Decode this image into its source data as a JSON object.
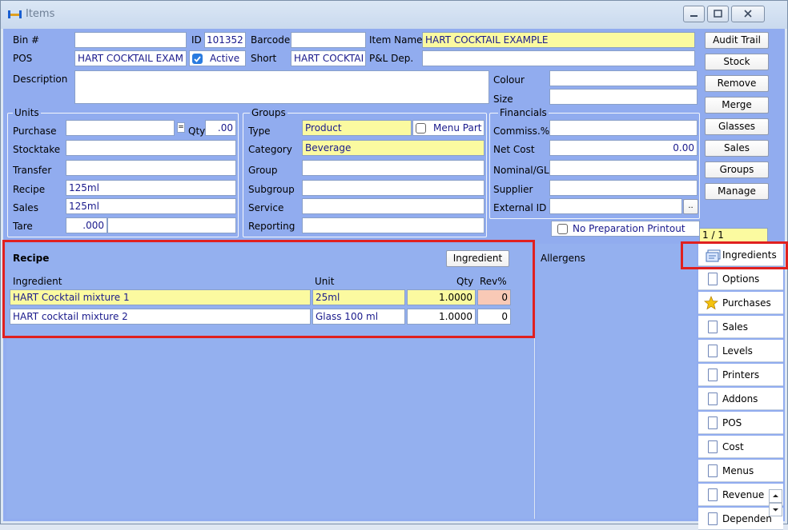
{
  "window": {
    "title": "Items"
  },
  "header": {
    "bin_label": "Bin #",
    "bin_value": "",
    "id_label": "ID",
    "id_value": "101352",
    "barcode_label": "Barcode",
    "barcode_value": "",
    "item_name_label": "Item Name",
    "item_name_value": "HART COCKTAIL EXAMPLE",
    "pos_label": "POS",
    "pos_value": "HART COCKTAIL EXAM",
    "active_label": "Active",
    "active_checked": true,
    "short_label": "Short",
    "short_value": "HART COCKTAI",
    "pl_dep_label": "P&L Dep.",
    "pl_dep_value": "",
    "description_label": "Description",
    "description_value": "",
    "colour_label": "Colour",
    "colour_value": "",
    "size_label": "Size",
    "size_value": ""
  },
  "units": {
    "title": "Units",
    "purchase_label": "Purchase",
    "purchase_value": "",
    "eq_label": "=",
    "qty_label": "Qty",
    "qty_value": ".00",
    "stocktake_label": "Stocktake",
    "stocktake_value": "",
    "transfer_label": "Transfer",
    "transfer_value": "",
    "recipe_label": "Recipe",
    "recipe_value": "125ml",
    "sales_label": "Sales",
    "sales_value": "125ml",
    "tare_label": "Tare",
    "tare_value": ".000"
  },
  "groups": {
    "title": "Groups",
    "type_label": "Type",
    "type_value": "Product",
    "menu_part_label": "Menu Part",
    "category_label": "Category",
    "category_value": "Beverage",
    "group_label": "Group",
    "group_value": "",
    "subgroup_label": "Subgroup",
    "subgroup_value": "",
    "service_label": "Service",
    "service_value": "",
    "reporting_label": "Reporting",
    "reporting_value": ""
  },
  "financials": {
    "title": "Financials",
    "commiss_label": "Commiss.%",
    "commiss_value": "",
    "net_cost_label": "Net Cost",
    "net_cost_value": "0.00",
    "nominal_label": "Nominal/GL",
    "nominal_value": "",
    "supplier_label": "Supplier",
    "supplier_value": "",
    "external_label": "External ID",
    "external_value": "",
    "ellipsis": "..",
    "no_prep_label": "No Preparation Printout"
  },
  "right_buttons": [
    "Audit Trail",
    "Stock",
    "Remove",
    "Merge",
    "Glasses",
    "Sales",
    "Groups",
    "Manage"
  ],
  "record_counter": "1 / 1",
  "recipe": {
    "title": "Recipe",
    "ingredient_button": "Ingredient",
    "columns": {
      "ingredient": "Ingredient",
      "unit": "Unit",
      "qty": "Qty",
      "rev": "Rev%"
    },
    "rows": [
      {
        "ingredient": "HART Cocktail mixture 1",
        "unit": "25ml",
        "qty": "1.0000",
        "rev": "0"
      },
      {
        "ingredient": "HART cocktail mixture 2",
        "unit": "Glass 100 ml",
        "qty": "1.0000",
        "rev": "0"
      }
    ]
  },
  "allergens": {
    "title": "Allergens"
  },
  "side_tabs": [
    {
      "label": "Ingredients",
      "icon": "ingredients-icon"
    },
    {
      "label": "Options",
      "icon": "document-icon"
    },
    {
      "label": "Purchases",
      "icon": "star-icon"
    },
    {
      "label": "Sales",
      "icon": "document-icon"
    },
    {
      "label": "Levels",
      "icon": "document-icon"
    },
    {
      "label": "Printers",
      "icon": "document-icon"
    },
    {
      "label": "Addons",
      "icon": "document-icon"
    },
    {
      "label": "POS",
      "icon": "document-icon"
    },
    {
      "label": "Cost",
      "icon": "document-icon"
    },
    {
      "label": "Menus",
      "icon": "document-icon"
    },
    {
      "label": "Revenue",
      "icon": "document-icon"
    },
    {
      "label": "Dependen",
      "icon": "document-icon"
    }
  ],
  "colors": {
    "highlight": "#e0201f",
    "yellow_field": "#fbfaa0",
    "panel": "#91acef",
    "checkbox_on": "#2a7bdf"
  }
}
